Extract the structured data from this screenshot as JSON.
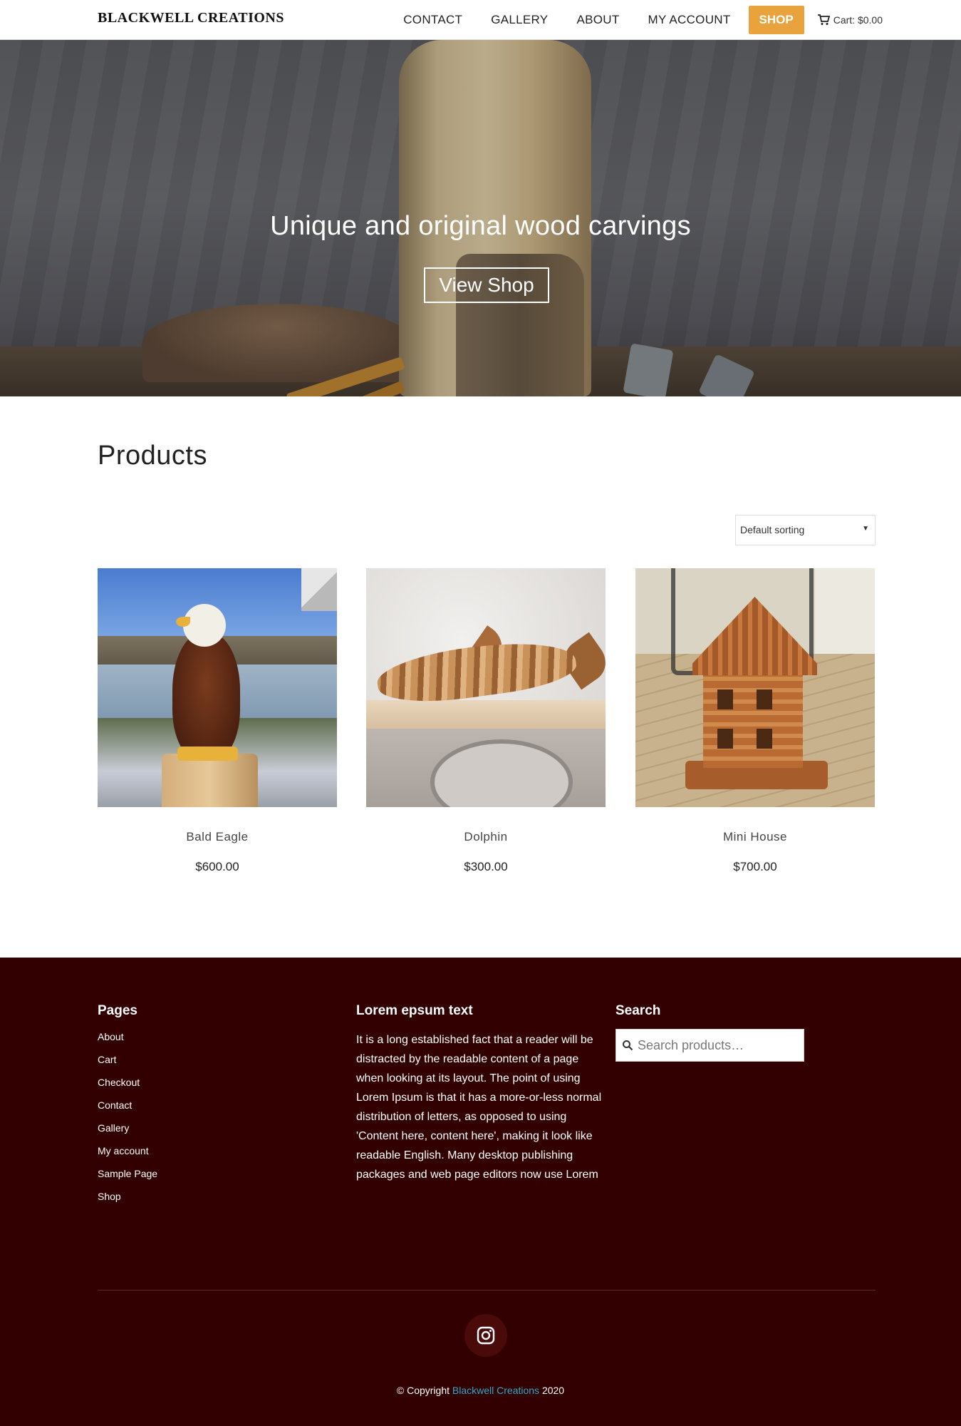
{
  "header": {
    "logo": "BLACKWELL CREATIONS",
    "nav": [
      "CONTACT",
      "GALLERY",
      "ABOUT",
      "MY ACCOUNT"
    ],
    "shop_label": "SHOP",
    "cart_label": "Cart: $0.00",
    "shop_color": "#e8a33d"
  },
  "hero": {
    "title": "Unique and original wood carvings",
    "button_label": "View Shop"
  },
  "products": {
    "title": "Products",
    "sort_selected": "Default sorting",
    "items": [
      {
        "name": "Bald Eagle",
        "price": "$600.00"
      },
      {
        "name": "Dolphin",
        "price": "$300.00"
      },
      {
        "name": "Mini House",
        "price": "$700.00"
      }
    ]
  },
  "footer": {
    "background": "#320000",
    "pages_title": "Pages",
    "pages": [
      "About",
      "Cart",
      "Checkout",
      "Contact",
      "Gallery",
      "My account",
      "Sample Page",
      "Shop"
    ],
    "text_title": "Lorem epsum text",
    "text_body": "It is a long established fact that a reader will be distracted by the readable content of a page when looking at its layout. The point of using Lorem Ipsum is that it has a more-or-less normal distribution of letters, as opposed to using 'Content here, content here', making it look like readable English. Many desktop publishing packages and web page editors now use Lorem",
    "search_title": "Search",
    "search_placeholder": "Search products…",
    "copyright_prefix": "© Copyright",
    "copyright_link": "Blackwell Creations",
    "copyright_year": "2020",
    "link_color": "#3aa6c6"
  }
}
